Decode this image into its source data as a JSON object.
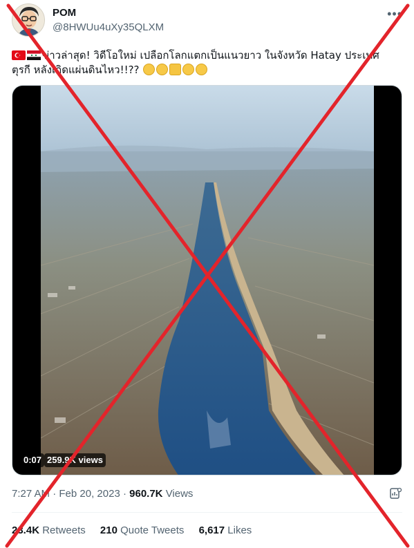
{
  "author": {
    "name": "POM",
    "handle": "@8HWUu4uXy35QLXM"
  },
  "menu_icon": "more-dots-icon",
  "text": {
    "line1": "ข่าวล่าสุด! วิดีโอใหม่ เปลือกโลกแตกเป็นแนวยาว ในจังหวัด Hatay ประเทศ",
    "line2": "ตุรกี หลังเกิดแผ่นดินไหว!!??"
  },
  "video": {
    "duration": "0:07",
    "views": "259.9K views"
  },
  "meta": {
    "time": "7:27 AM",
    "date": "Feb 20, 2023",
    "views_count": "960.7K",
    "views_label": "Views"
  },
  "stats": {
    "retweets_count": "23.4K",
    "retweets_label": "Retweets",
    "quotes_count": "210",
    "quotes_label": "Quote Tweets",
    "likes_count": "6,617",
    "likes_label": "Likes"
  },
  "colors": {
    "text": "#0f1419",
    "secondary": "#536471",
    "cross": "#e3242b"
  }
}
